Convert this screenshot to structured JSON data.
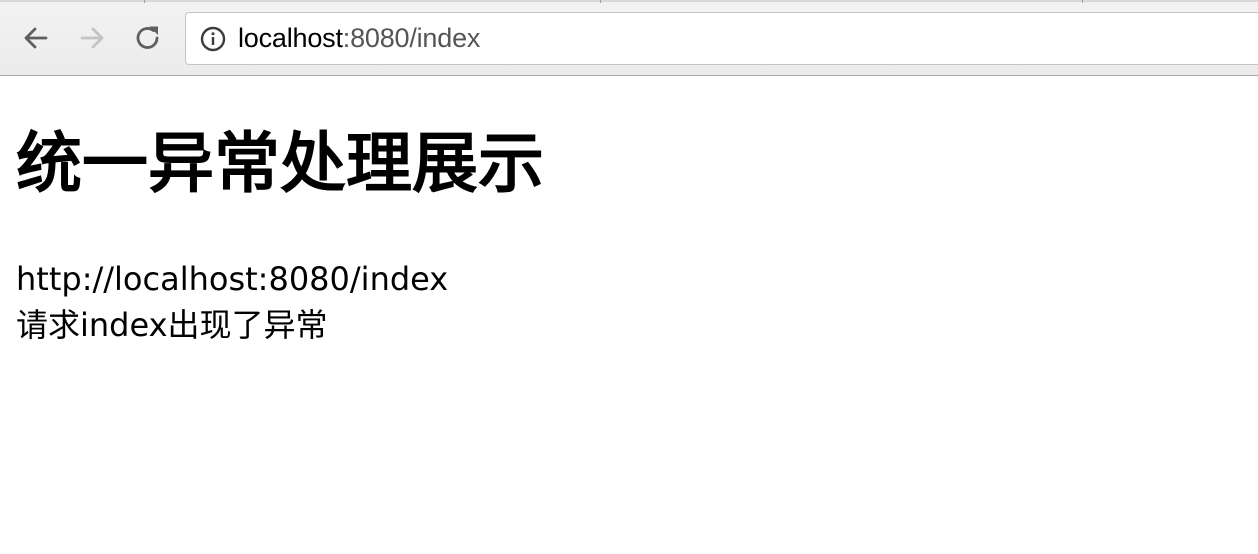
{
  "browser": {
    "url_host": "localhost",
    "url_path": ":8080/index",
    "icons": {
      "back": "arrow-left-icon",
      "forward": "arrow-right-icon",
      "reload": "reload-icon",
      "site_info": "info-circle-icon"
    }
  },
  "page": {
    "heading": "统一异常处理展示",
    "request_url": "http://localhost:8080/index",
    "message": "请求index出现了异常"
  }
}
